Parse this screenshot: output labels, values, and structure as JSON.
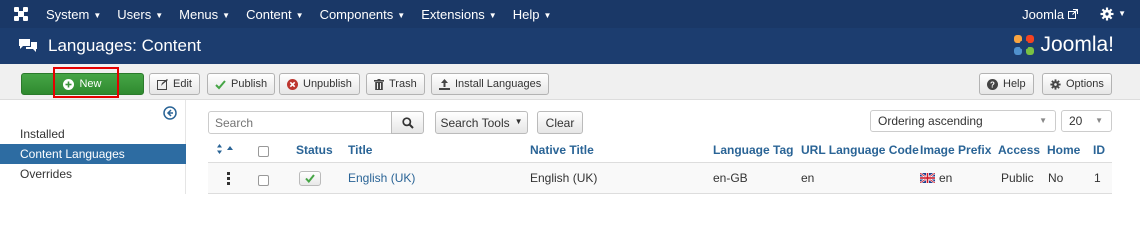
{
  "topnav": {
    "menu": [
      {
        "label": "System"
      },
      {
        "label": "Users"
      },
      {
        "label": "Menus"
      },
      {
        "label": "Content"
      },
      {
        "label": "Components"
      },
      {
        "label": "Extensions"
      },
      {
        "label": "Help"
      }
    ],
    "site_link": "Joomla"
  },
  "titlebar": {
    "title": "Languages: Content",
    "brand": "Joomla!"
  },
  "toolbar": {
    "new": "New",
    "edit": "Edit",
    "publish": "Publish",
    "unpublish": "Unpublish",
    "trash": "Trash",
    "install": "Install Languages",
    "help": "Help",
    "options": "Options"
  },
  "sidebar": {
    "items": [
      {
        "label": "Installed",
        "active": false
      },
      {
        "label": "Content Languages",
        "active": true
      },
      {
        "label": "Overrides",
        "active": false
      }
    ]
  },
  "filters": {
    "search_placeholder": "Search",
    "search_tools": "Search Tools",
    "clear": "Clear",
    "ordering": "Ordering ascending",
    "limit": "20"
  },
  "table": {
    "headers": {
      "status": "Status",
      "title": "Title",
      "native_title": "Native Title",
      "language_tag": "Language Tag",
      "url_code": "URL Language Code",
      "image_prefix": "Image Prefix",
      "access": "Access",
      "home": "Home",
      "id": "ID"
    },
    "rows": [
      {
        "title": "English (UK)",
        "native_title": "English (UK)",
        "language_tag": "en-GB",
        "url_code": "en",
        "image_prefix": "en",
        "access": "Public",
        "home": "No",
        "id": "1",
        "published": true
      }
    ]
  },
  "colors": {
    "nav_bg": "#1a3867",
    "title_bg": "#1c3d6f",
    "new_button": "#46a546",
    "active_sidebar": "#2d6ca2",
    "link": "#2a6496",
    "highlight_box": "#e60000"
  }
}
